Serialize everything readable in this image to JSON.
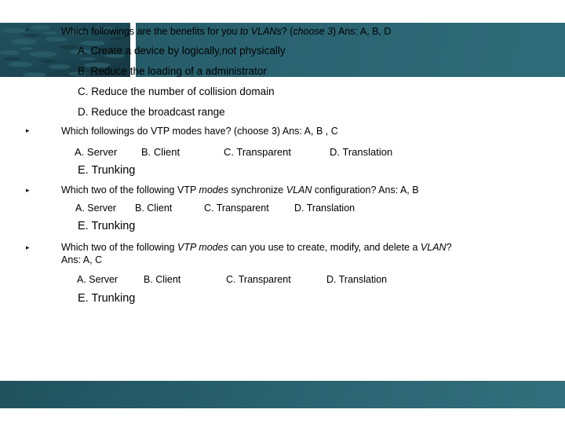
{
  "slide": {
    "background_color": "#ffffff",
    "banner_color": "#2a6270",
    "photo_alt": "school-of-fish-underwater"
  },
  "bullet_glyph": "▸",
  "questions": [
    {
      "id": "q1",
      "stem_parts": [
        {
          "text": "Which followings are the benefits for you ",
          "italic": false
        },
        {
          "text": "to VLANs",
          "italic": true
        },
        {
          "text": "? (",
          "italic": false
        },
        {
          "text": "choose 3",
          "italic": true
        },
        {
          "text": ")  Ans: A, B, D",
          "italic": false
        }
      ],
      "stem_plain": "Which followings are the benefits for you to VLANs? (choose 3)  Ans: A, B, D",
      "options": [
        "A. Create a device by logically,not physically",
        "B. Reduce the loading of a administrator",
        "C. Reduce the number of collision domain",
        "D. Reduce the broadcast range"
      ]
    },
    {
      "id": "q2",
      "stem_parts": [
        {
          "text": "Which followings do VTP modes have? (choose 3) Ans: A, B , C",
          "italic": false
        }
      ],
      "stem_plain": "Which followings do VTP modes have? (choose 3) Ans: A, B , C",
      "choices": [
        "A. Server",
        "B. Client",
        "C. Transparent",
        "D. Translation"
      ],
      "extra_choice": "E. Trunking"
    },
    {
      "id": "q3",
      "stem_parts": [
        {
          "text": "Which two of the following VTP ",
          "italic": false
        },
        {
          "text": "modes",
          "italic": true
        },
        {
          "text": " synchronize ",
          "italic": false
        },
        {
          "text": "VLAN",
          "italic": true
        },
        {
          "text": " configuration?  Ans: A, B",
          "italic": false
        }
      ],
      "stem_plain": "Which two of the following VTP modes synchronize VLAN configuration?  Ans: A, B",
      "choices": [
        "A. Server",
        "B. Client",
        "C. Transparent",
        "D. Translation"
      ],
      "extra_choice": "E. Trunking"
    },
    {
      "id": "q4",
      "stem_parts": [
        {
          "text": "Which two of the following ",
          "italic": false
        },
        {
          "text": "VTP modes",
          "italic": true
        },
        {
          "text": " can you use to create, modify, and delete a ",
          "italic": false
        },
        {
          "text": "VLAN",
          "italic": true
        },
        {
          "text": "?",
          "italic": false
        }
      ],
      "stem_plain": "Which two of the following VTP modes can you use to create, modify, and delete a VLAN?",
      "stem_line2": "Ans: A, C",
      "choices": [
        "A. Server",
        "B. Client",
        "C. Transparent",
        "D. Translation"
      ],
      "extra_choice": "E. Trunking"
    }
  ]
}
